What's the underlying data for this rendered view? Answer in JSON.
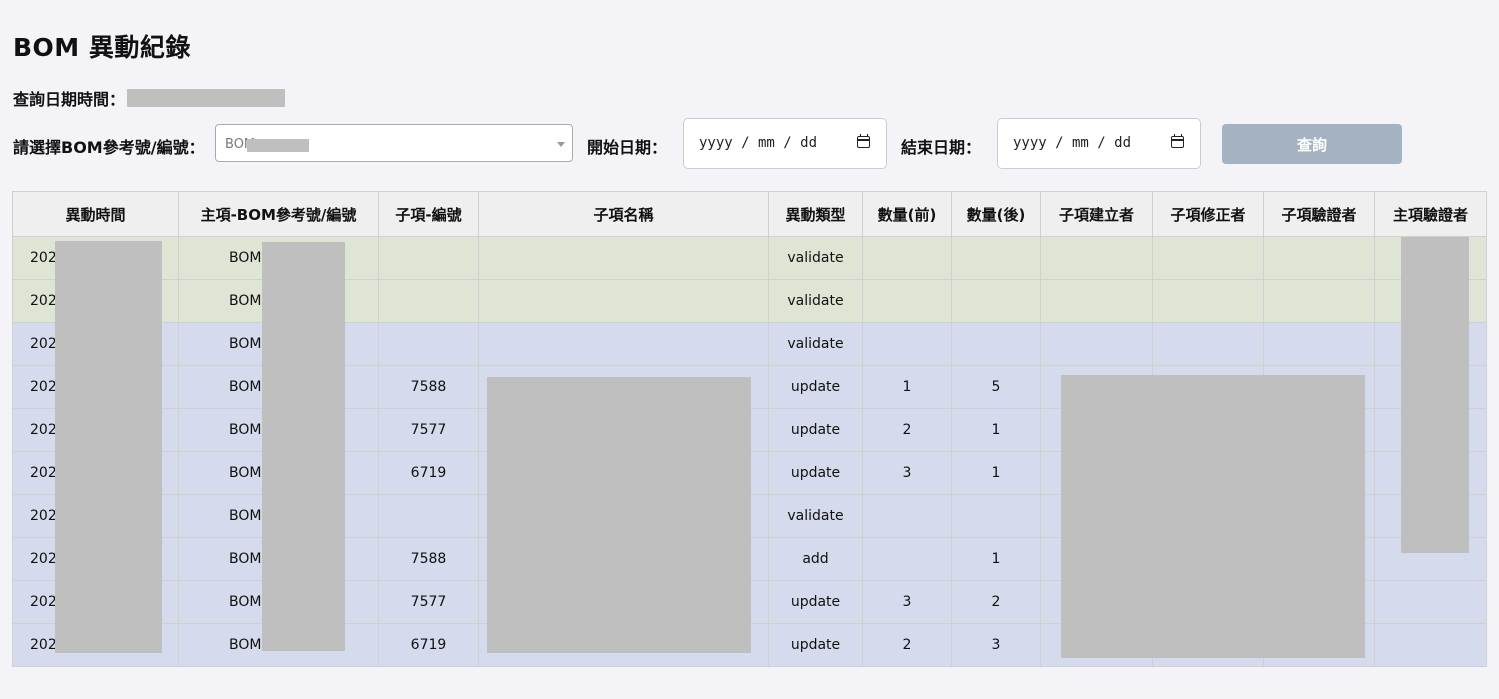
{
  "page": {
    "title": "BOM 異動紀錄",
    "query_datetime_label": "查詢日期時間："
  },
  "filters": {
    "bom_label": "請選擇BOM參考號/編號：",
    "bom_value": "BOM",
    "start_label": "開始日期：",
    "start_placeholder": "yyyy / mm / dd",
    "end_label": "結束日期：",
    "end_placeholder": "yyyy / mm / dd",
    "query_button": "查詢"
  },
  "table": {
    "headers": [
      "異動時間",
      "主項-BOM參考號/編號",
      "子項-編號",
      "子項名稱",
      "異動類型",
      "數量(前)",
      "數量(後)",
      "子項建立者",
      "子項修正者",
      "子項驗證者",
      "主項驗證者"
    ],
    "rows": [
      {
        "time": "202",
        "bom": "BOM",
        "item_no": "",
        "item_name": "",
        "type": "validate",
        "qty_before": "",
        "qty_after": "",
        "creator": "",
        "modifier": "",
        "verifier": "",
        "main_verifier": "",
        "color": "green"
      },
      {
        "time": "202",
        "bom": "BOM",
        "item_no": "",
        "item_name": "",
        "type": "validate",
        "qty_before": "",
        "qty_after": "",
        "creator": "",
        "modifier": "",
        "verifier": "",
        "main_verifier": "",
        "color": "green"
      },
      {
        "time": "202",
        "bom": "BOM",
        "item_no": "",
        "item_name": "",
        "type": "validate",
        "qty_before": "",
        "qty_after": "",
        "creator": "",
        "modifier": "",
        "verifier": "",
        "main_verifier": "",
        "color": "blue"
      },
      {
        "time": "202",
        "bom": "BOM",
        "item_no": "7588",
        "item_name": "",
        "type": "update",
        "qty_before": "1",
        "qty_after": "5",
        "creator": "",
        "modifier": "",
        "verifier": "",
        "main_verifier": "",
        "color": "blue"
      },
      {
        "time": "202",
        "bom": "BOM",
        "item_no": "7577",
        "item_name": "",
        "type": "update",
        "qty_before": "2",
        "qty_after": "1",
        "creator": "",
        "modifier": "",
        "verifier": "",
        "main_verifier": "",
        "color": "blue"
      },
      {
        "time": "202",
        "bom": "BOM",
        "item_no": "6719",
        "item_name": "",
        "type": "update",
        "qty_before": "3",
        "qty_after": "1",
        "creator": "",
        "modifier": "",
        "verifier": "",
        "main_verifier": "",
        "color": "blue"
      },
      {
        "time": "202",
        "bom": "BOM",
        "item_no": "",
        "item_name": "",
        "type": "validate",
        "qty_before": "",
        "qty_after": "",
        "creator": "",
        "modifier": "",
        "verifier": "",
        "main_verifier": "",
        "color": "blue"
      },
      {
        "time": "202",
        "bom": "BOM",
        "item_no": "7588",
        "item_name": "",
        "type": "add",
        "qty_before": "",
        "qty_after": "1",
        "creator": "",
        "modifier": "",
        "verifier": "",
        "main_verifier": "",
        "color": "blue"
      },
      {
        "time": "202",
        "bom": "BOM",
        "item_no": "7577",
        "item_name": "",
        "type": "update",
        "qty_before": "3",
        "qty_after": "2",
        "creator": "",
        "modifier": "",
        "verifier": "",
        "main_verifier": "",
        "color": "blue"
      },
      {
        "time": "202",
        "bom": "BOM",
        "item_no": "6719",
        "item_name": "",
        "type": "update",
        "qty_before": "2",
        "qty_after": "3",
        "creator": "",
        "modifier": "",
        "verifier": "",
        "main_verifier": "",
        "color": "blue"
      }
    ]
  },
  "colors": {
    "row_green": "#dfe5d5",
    "row_blue": "#d5dbec",
    "button_bg": "#a5b2c1",
    "redaction": "#bfbfbf"
  }
}
